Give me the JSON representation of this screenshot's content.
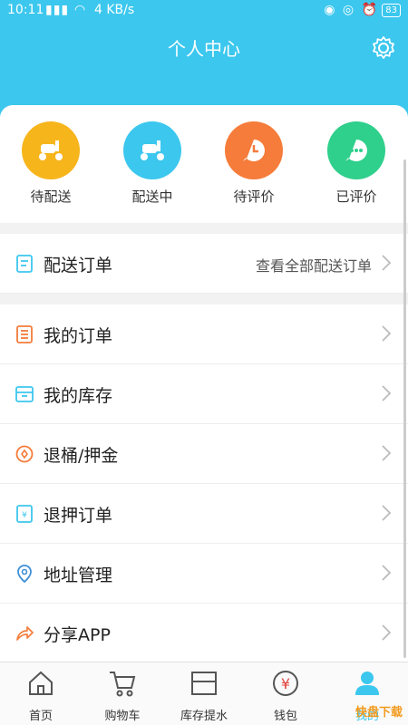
{
  "status": {
    "time": "10:11",
    "speed": "4 KB/s",
    "battery": "83"
  },
  "header": {
    "title": "个人中心"
  },
  "orders": [
    {
      "label": "待配送",
      "color": "#f7b51c"
    },
    {
      "label": "配送中",
      "color": "#3cc7ee"
    },
    {
      "label": "待评价",
      "color": "#f57c3a"
    },
    {
      "label": "已评价",
      "color": "#2fcf8c"
    }
  ],
  "menu": {
    "delivery_orders": {
      "label": "配送订单",
      "extra": "查看全部配送订单"
    },
    "items": [
      {
        "label": "我的订单"
      },
      {
        "label": "我的库存"
      },
      {
        "label": "退桶/押金"
      },
      {
        "label": "退押订单"
      },
      {
        "label": "地址管理"
      },
      {
        "label": "分享APP"
      }
    ]
  },
  "tabs": [
    {
      "label": "首页"
    },
    {
      "label": "购物车"
    },
    {
      "label": "库存提水"
    },
    {
      "label": "钱包"
    },
    {
      "label": "我的"
    }
  ],
  "colors": {
    "primary": "#3cc7ee",
    "accent_orange": "#f57c3a"
  },
  "watermark": "快盘下载"
}
